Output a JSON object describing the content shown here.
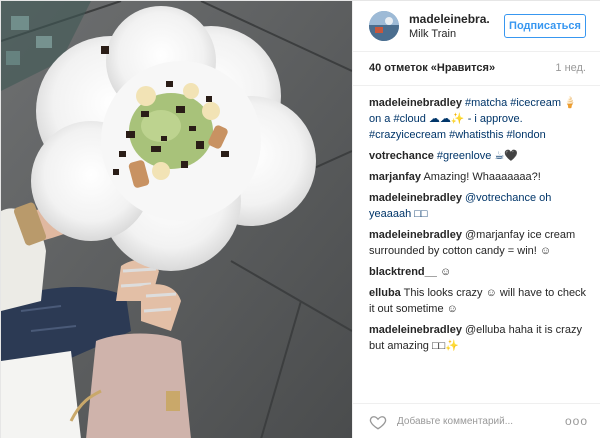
{
  "post": {
    "username": "madeleinebra...",
    "location": "Milk Train",
    "follow_label": "Подписаться",
    "likes": "40 отметок «Нравится»",
    "time": "1 нед."
  },
  "comments": [
    {
      "user": "madeleinebradley",
      "text": "#matcha #icecream 🍦 on a #cloud ☁☁✨ - i approve. #crazyicecream #whatisthis #london"
    },
    {
      "user": "votrechance",
      "text": "#greenlove ☕🖤"
    },
    {
      "user": "marjanfay",
      "text": "Amazing! Whaaaaaaa?!"
    },
    {
      "user": "madeleinebradley",
      "text": "@votrechance oh yeaaaah □□"
    },
    {
      "user": "madeleinebradley",
      "text": "@marjanfay ice cream surrounded by cotton candy = win! ☺"
    },
    {
      "user": "blacktrend__",
      "text": "☺"
    },
    {
      "user": "elluba",
      "text": "This looks crazy ☺ will have to check it out sometime ☺"
    },
    {
      "user": "madeleinebradley",
      "text": "@elluba haha it is crazy but amazing □□✨"
    }
  ],
  "footer": {
    "placeholder": "Добавьте комментарий...",
    "more_label": "ooo",
    "heart_icon": "heart-icon"
  },
  "colors": {
    "accent": "#3897f0",
    "hashtag": "#003569",
    "muted": "#999999"
  }
}
